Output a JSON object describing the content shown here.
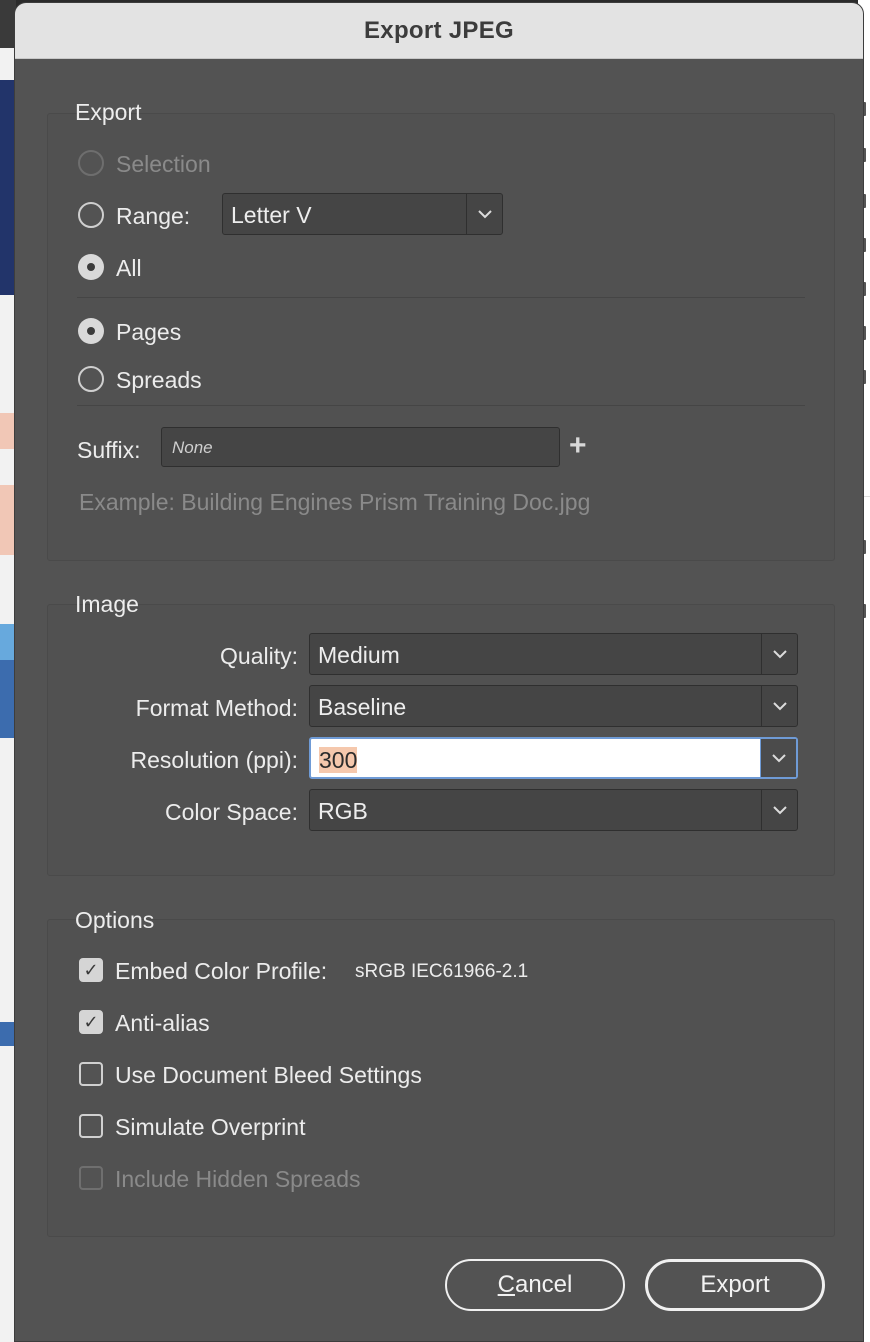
{
  "dialog": {
    "title": "Export JPEG"
  },
  "export": {
    "legend": "Export",
    "selection_label": "Selection",
    "range_label": "Range:",
    "range_value": "Letter V",
    "all_label": "All",
    "pages_label": "Pages",
    "spreads_label": "Spreads",
    "suffix_label": "Suffix:",
    "suffix_placeholder": "None",
    "example_text": "Example:  Building Engines Prism Training Doc.jpg"
  },
  "image": {
    "legend": "Image",
    "quality_label": "Quality:",
    "quality_value": "Medium",
    "format_label": "Format Method:",
    "format_value": "Baseline",
    "resolution_label": "Resolution (ppi):",
    "resolution_value": "300",
    "colorspace_label": "Color Space:",
    "colorspace_value": "RGB"
  },
  "options": {
    "legend": "Options",
    "embed_label": "Embed Color Profile:",
    "embed_profile": "sRGB IEC61966-2.1",
    "antialias_label": "Anti-alias",
    "bleed_label": "Use Document Bleed Settings",
    "overprint_label": "Simulate Overprint",
    "hidden_label": "Include Hidden Spreads"
  },
  "buttons": {
    "cancel_first": "C",
    "cancel_rest": "ancel",
    "export_label": "Export"
  },
  "colors": {
    "dialog_bg": "#535353",
    "titlebar_bg": "#e3e3e3",
    "focus_ring": "#6f9bd6",
    "text_highlight": "#f5c8ad"
  }
}
